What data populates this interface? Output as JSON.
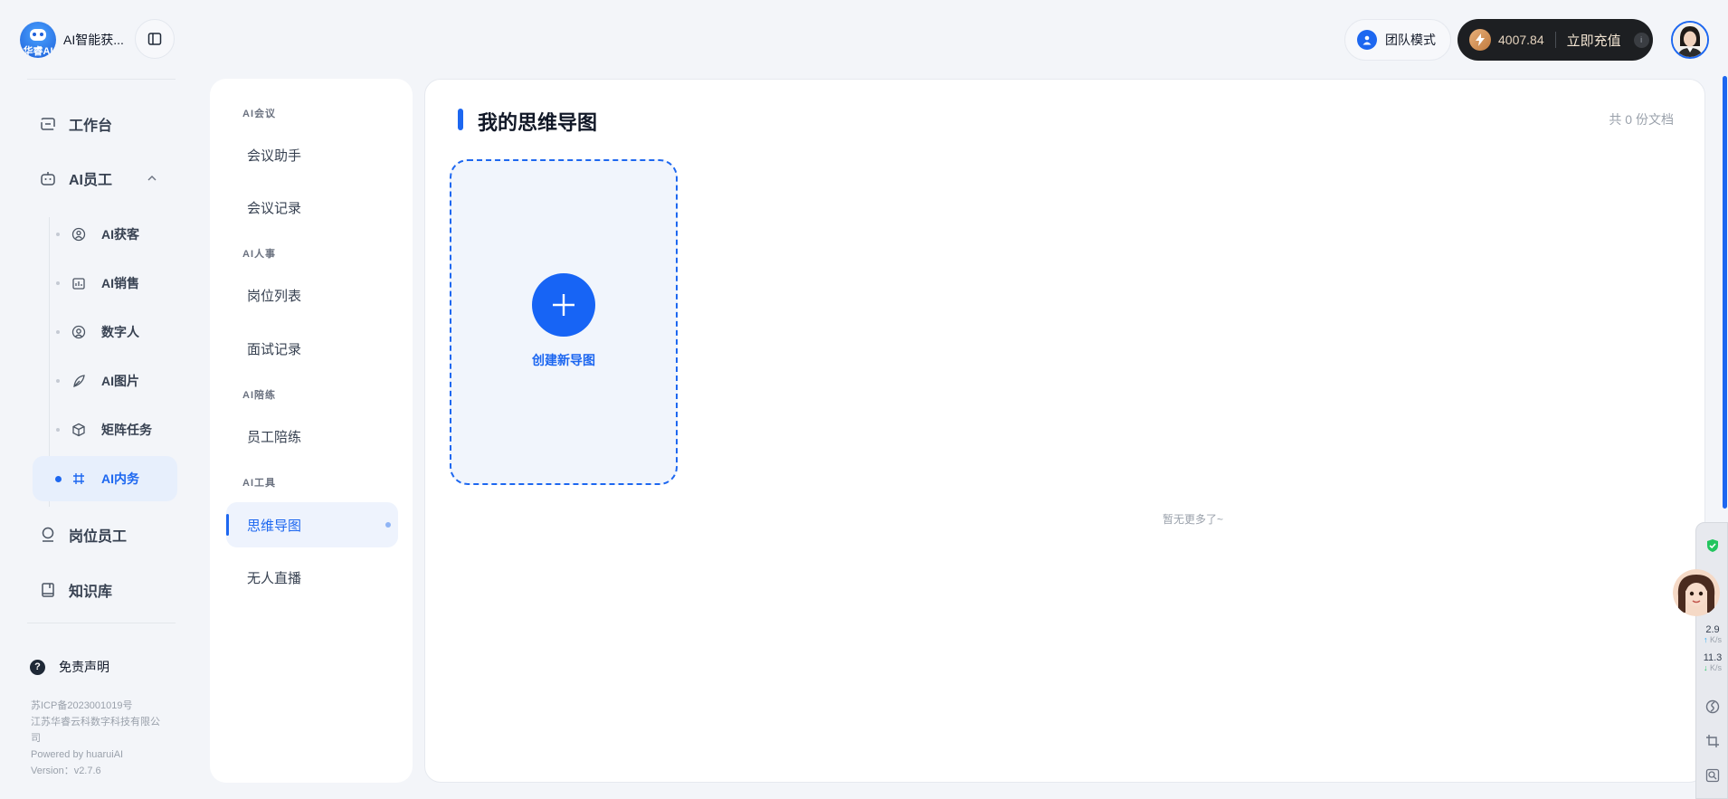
{
  "brand": {
    "name": "AI智能获...",
    "logo_text": "华睿AI"
  },
  "nav": {
    "workbench": "工作台",
    "ai_staff": "AI员工",
    "sub_items": [
      {
        "label": "AI获客",
        "icon": "user-circle-icon"
      },
      {
        "label": "AI销售",
        "icon": "chart-icon"
      },
      {
        "label": "数字人",
        "icon": "face-icon"
      },
      {
        "label": "AI图片",
        "icon": "leaf-icon"
      },
      {
        "label": "矩阵任务",
        "icon": "cube-icon"
      },
      {
        "label": "AI内务",
        "icon": "hash-icon"
      }
    ],
    "position_staff": "岗位员工",
    "knowledge_base": "知识库",
    "disclaimer": "免责声明"
  },
  "footer": {
    "icp": "苏ICP备2023001019号",
    "company": "江苏华睿云科数字科技有限公司",
    "powered": "Powered by huaruiAI",
    "version": "Version：v2.7.6"
  },
  "menu": {
    "groups": [
      "AI会议",
      "AI人事",
      "AI陪练",
      "AI工具"
    ],
    "items": [
      "会议助手",
      "会议记录",
      "岗位列表",
      "面试记录",
      "员工陪练",
      "思维导图",
      "无人直播"
    ],
    "active": "思维导图"
  },
  "content": {
    "title": "我的思维导图",
    "doc_count": "共 0 份文档",
    "create_label": "创建新导图",
    "no_more": "暂无更多了~"
  },
  "header": {
    "team_mode": "团队模式",
    "credits": "4007.84",
    "recharge": "立即充值",
    "info": "i"
  },
  "speed_widget": {
    "up_value": "2.9",
    "up_unit": "K/s",
    "down_value": "11.3",
    "down_unit": "K/s"
  },
  "colors": {
    "accent": "#1d67f0",
    "background": "#f3f5f9",
    "dark_pill": "#1d1f22"
  }
}
